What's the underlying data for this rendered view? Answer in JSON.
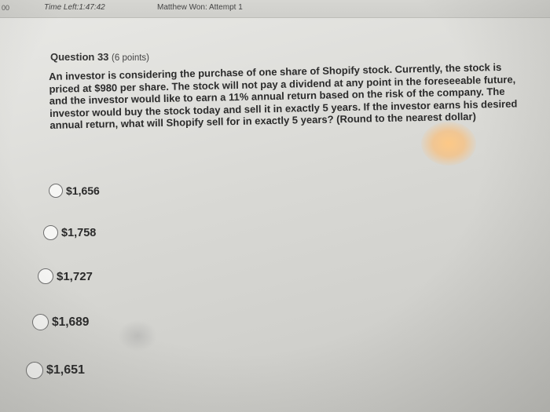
{
  "top_bar": {
    "mark": "00",
    "time_left": "Time Left:1:47:42",
    "attempt": "Matthew Won: Attempt 1"
  },
  "question": {
    "number": "Question 33",
    "points": "(6 points)",
    "text": "An investor is considering the purchase of one share of Shopify stock. Currently, the stock is priced at $980 per share. The stock will not pay a dividend at any point in the foreseeable future, and the investor would like to earn a 11% annual return based on the risk of the company. The investor would buy the stock today and sell it in exactly 5 years. If the investor earns his desired annual return, what will Shopify sell for in exactly 5 years? (Round to the nearest dollar)"
  },
  "options": [
    {
      "label": "$1,656",
      "selected": false
    },
    {
      "label": "$1,758",
      "selected": false
    },
    {
      "label": "$1,727",
      "selected": false
    },
    {
      "label": "$1,689",
      "selected": false
    },
    {
      "label": "$1,651",
      "selected": false
    }
  ]
}
